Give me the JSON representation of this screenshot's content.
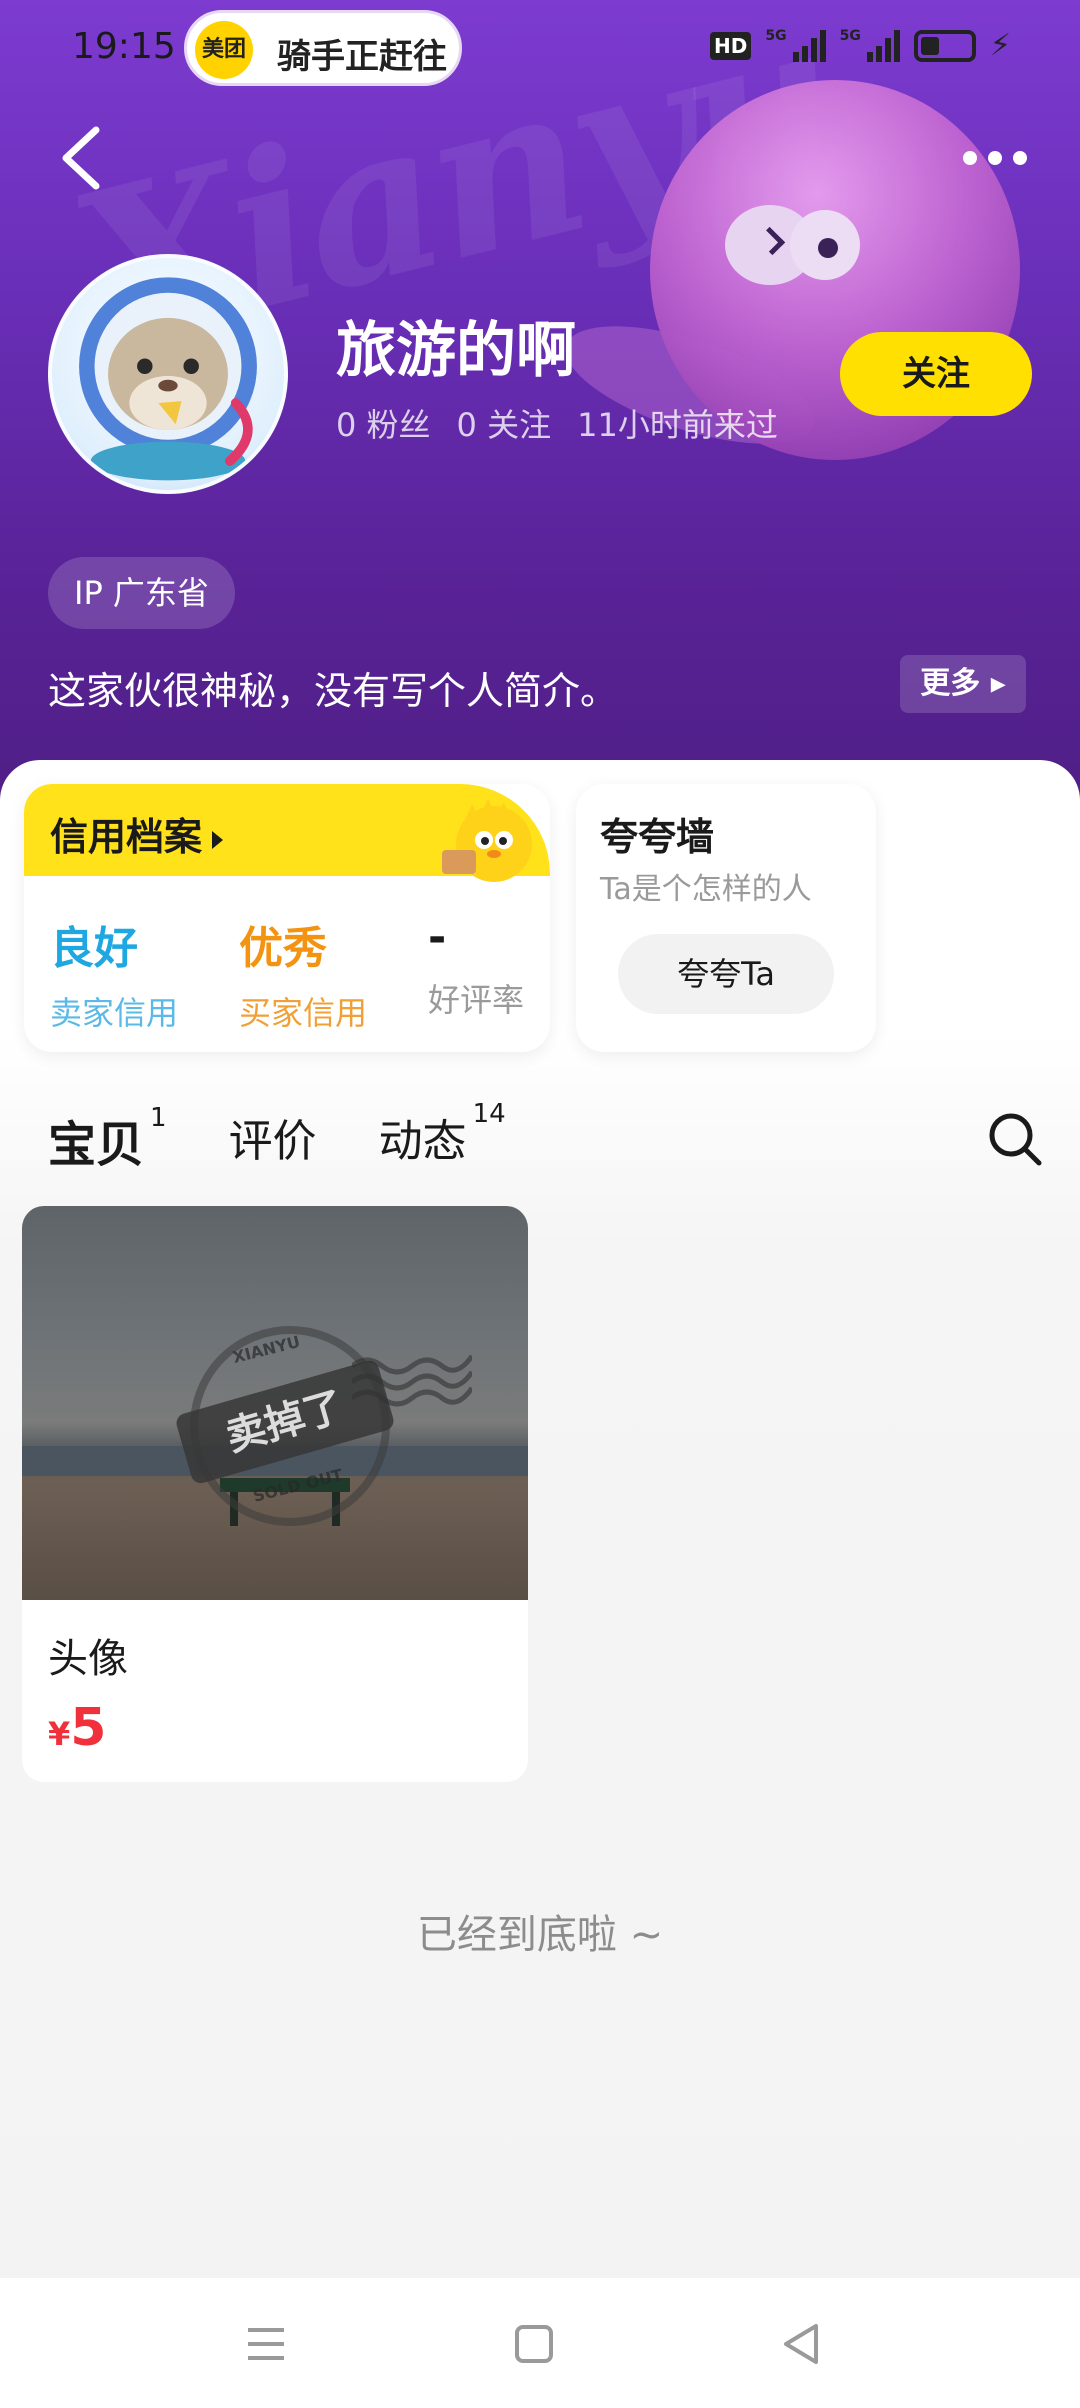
{
  "status_bar": {
    "time": "19:15",
    "notification_app": "美团",
    "notification_text": "骑手正赶往",
    "hd_label": "HD",
    "network_label_1": "5G",
    "network_label_2": "5G"
  },
  "profile": {
    "name": "旅游的啊",
    "fans": "0 粉丝",
    "following": "0 关注",
    "last_seen": "11小时前来过",
    "follow_label": "关注",
    "ip": "IP 广东省",
    "bio": "这家伙很神秘，没有写个人简介。",
    "more_label": "更多",
    "watermark": "Xianyu"
  },
  "credit": {
    "title": "信用档案",
    "items": [
      {
        "value": "良好",
        "label": "卖家信用",
        "color": "#1ea7e1"
      },
      {
        "value": "优秀",
        "label": "买家信用",
        "color": "#f29312"
      },
      {
        "value": "-",
        "label": "好评率",
        "color": "#1a1a1a"
      }
    ]
  },
  "praise": {
    "title": "夸夸墙",
    "subtitle": "Ta是个怎样的人",
    "button": "夸夸Ta"
  },
  "tabs": [
    {
      "label": "宝贝",
      "count": "1",
      "active": true
    },
    {
      "label": "评价",
      "count": "",
      "active": false
    },
    {
      "label": "动态",
      "count": "14",
      "active": false
    }
  ],
  "products": [
    {
      "title": "头像",
      "price_symbol": "¥",
      "price": "5",
      "stamp_text": "卖掉了",
      "stamp_top": "XIANYU",
      "stamp_bottom": "SOLD OUT"
    }
  ],
  "end_text": "已经到底啦 ~",
  "colors": {
    "accent_yellow": "#ffe000",
    "price_red": "#f0303a",
    "header_purple": "#6a2fb9"
  },
  "icons": {
    "back": "back-arrow-icon",
    "more": "more-dots-icon",
    "search": "search-icon",
    "nav_menu": "menu-icon",
    "nav_home": "home-square-icon",
    "nav_back": "back-triangle-icon"
  }
}
